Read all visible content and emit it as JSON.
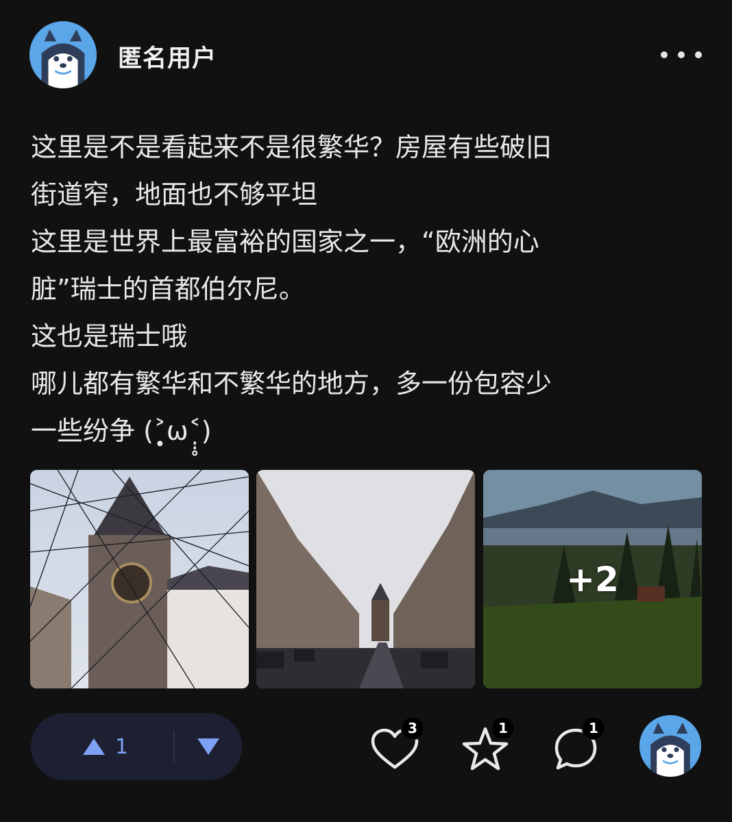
{
  "author": {
    "name": "匿名用户",
    "avatar_icon": "husky-avatar-icon"
  },
  "menu_icon": "more-horizontal-icon",
  "post": {
    "lines": [
      "这里是不是看起来不是很繁华？房屋有些破旧",
      "街道窄，地面也不够平坦",
      "这里是世界上最富裕的国家之一，“欧洲的心",
      "脏”瑞士的首都伯尔尼。",
      "这也是瑞士哦",
      "哪儿都有繁华和不繁华的地方，多一份包容少",
      "一些纷争 (˃̣̣̥ω˂̣̣̥)"
    ]
  },
  "photos": {
    "items": [
      {
        "subject": "clock-tower-photo"
      },
      {
        "subject": "street-photo"
      },
      {
        "subject": "lake-landscape-photo"
      }
    ],
    "more_label": "+2"
  },
  "vote": {
    "up_count": "1",
    "up_icon": "triangle-up-icon",
    "down_icon": "triangle-down-icon",
    "accent": "#7ea1f5"
  },
  "actions": {
    "like": {
      "icon": "heart-icon",
      "count": "3"
    },
    "favorite": {
      "icon": "star-icon",
      "count": "1"
    },
    "comment": {
      "icon": "comment-bubble-icon",
      "count": "1"
    }
  }
}
